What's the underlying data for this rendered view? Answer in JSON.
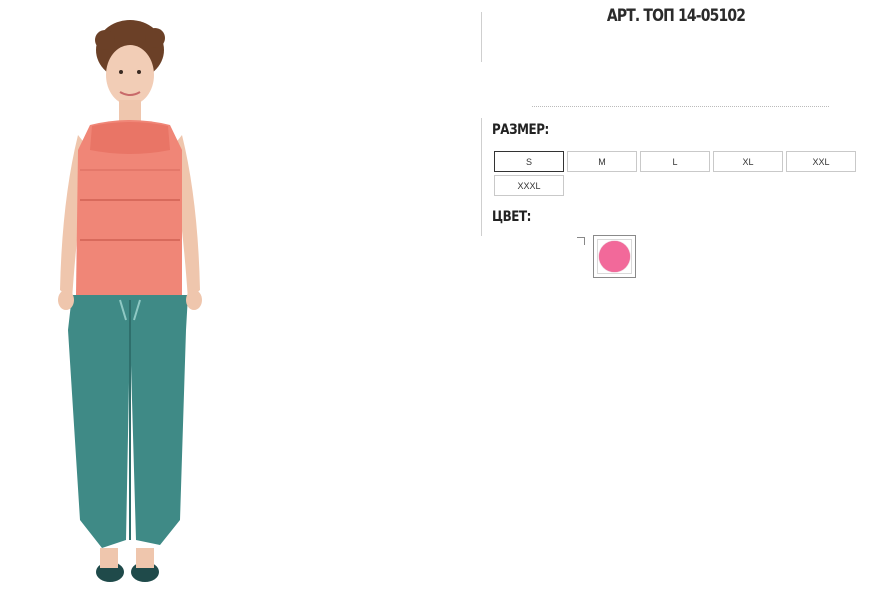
{
  "product": {
    "article": "АРТ. ТОП 14-05102"
  },
  "sizes": {
    "label": "РАЗМЕР:",
    "options": [
      "S",
      "M",
      "L",
      "XL",
      "XXL",
      "XXXL"
    ],
    "selected": "S"
  },
  "colors": {
    "label": "ЦВЕТ:",
    "swatches": [
      {
        "name": "pink",
        "hex": "#f2699a"
      }
    ]
  },
  "photo": {
    "top_color": "#f08677",
    "pants_color": "#3f8a86",
    "shoes_color": "#1f4a4a"
  }
}
